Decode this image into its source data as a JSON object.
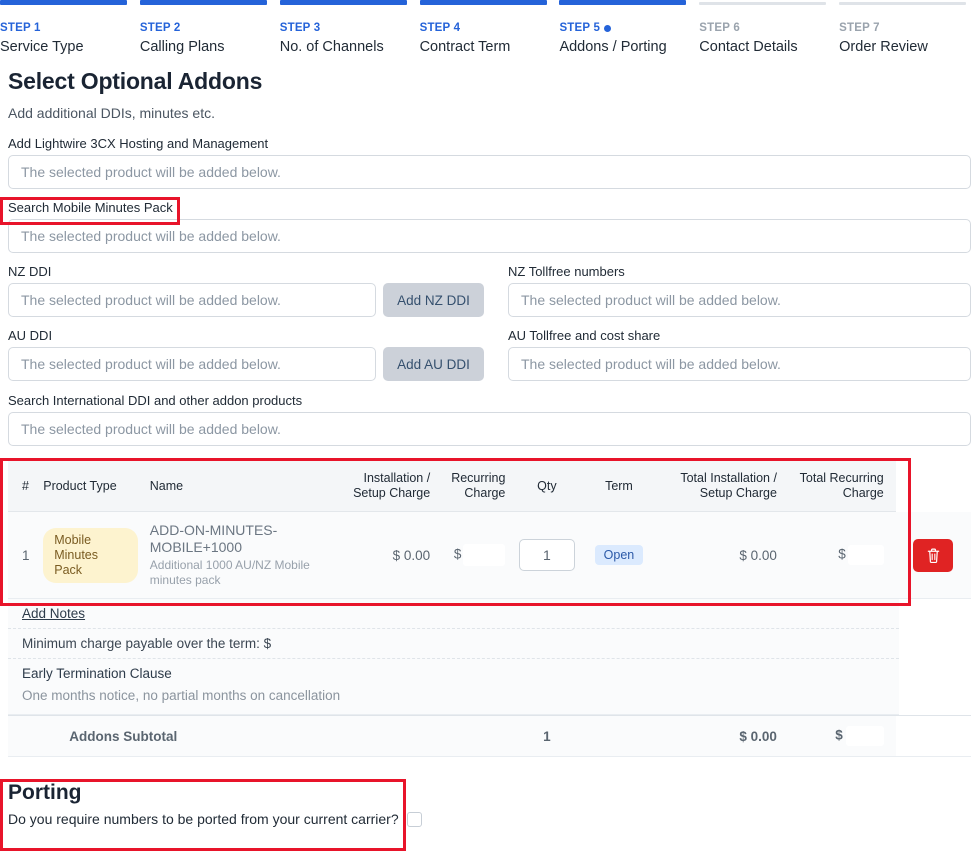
{
  "stepper": {
    "steps": [
      {
        "num": "STEP 1",
        "label": "Service Type",
        "state": "done"
      },
      {
        "num": "STEP 2",
        "label": "Calling Plans",
        "state": "done"
      },
      {
        "num": "STEP 3",
        "label": "No. of Channels",
        "state": "done"
      },
      {
        "num": "STEP 4",
        "label": "Contract Term",
        "state": "done"
      },
      {
        "num": "STEP 5",
        "label": "Addons / Porting",
        "state": "current"
      },
      {
        "num": "STEP 6",
        "label": "Contact Details",
        "state": "upcoming"
      },
      {
        "num": "STEP 7",
        "label": "Order Review",
        "state": "upcoming"
      }
    ],
    "current_dot_icon": "current-step-dot-icon"
  },
  "header": {
    "title": "Select Optional Addons",
    "subtitle": "Add additional DDIs, minutes etc."
  },
  "form": {
    "placeholder": "The selected product will be added below.",
    "hosting_label": "Add Lightwire 3CX Hosting and Management",
    "mobile_minutes_label": "Search Mobile Minutes Pack",
    "nz_ddi_label": "NZ DDI",
    "nz_tollfree_label": "NZ Tollfree numbers",
    "au_ddi_label": "AU DDI",
    "au_tollfree_label": "AU Tollfree and cost share",
    "international_label": "Search International DDI and other addon products",
    "add_nz_ddi_button": "Add NZ DDI",
    "add_au_ddi_button": "Add AU DDI"
  },
  "table": {
    "headers": {
      "index": "#",
      "product_type": "Product Type",
      "name": "Name",
      "install_charge": "Installation / Setup Charge",
      "recurring_charge": "Recurring Charge",
      "qty": "Qty",
      "term": "Term",
      "total_install": "Total Installation / Setup Charge",
      "total_recurring": "Total Recurring Charge"
    },
    "rows": [
      {
        "index": "1",
        "product_type": "Mobile Minutes Pack",
        "name": "ADD-ON-MINUTES-MOBILE+1000",
        "description": "Additional 1000 AU/NZ Mobile minutes pack",
        "install_charge": "$ 0.00",
        "recurring_charge_symbol": "$",
        "recurring_charge_value": "",
        "qty": "1",
        "term": "Open",
        "total_install": "$ 0.00",
        "total_recurring_symbol": "$",
        "total_recurring_value": "",
        "delete_icon": "trash-icon"
      }
    ],
    "add_notes_label": "Add Notes",
    "minimum_charge_label": "Minimum charge payable over the term: $",
    "early_termination_title": "Early Termination Clause",
    "early_termination_body": "One months notice, no partial months on cancellation",
    "subtotal": {
      "label": "Addons Subtotal",
      "qty": "1",
      "total_install": "$ 0.00",
      "total_recurring_symbol": "$",
      "total_recurring_value": ""
    }
  },
  "porting": {
    "title": "Porting",
    "question": "Do you require numbers to be ported from your current carrier?",
    "checked": false
  },
  "colors": {
    "accent_blue": "#2563d9",
    "inactive_gray": "#dfe3e8",
    "pill_yellow_bg": "#fdf3cf",
    "pill_yellow_text": "#7a5c22",
    "badge_open_bg": "#dbeafe",
    "badge_open_text": "#2c5aa8",
    "delete_red": "#e02323",
    "highlight_red": "#e8142a",
    "add_button_gray": "#ccd1d9"
  }
}
